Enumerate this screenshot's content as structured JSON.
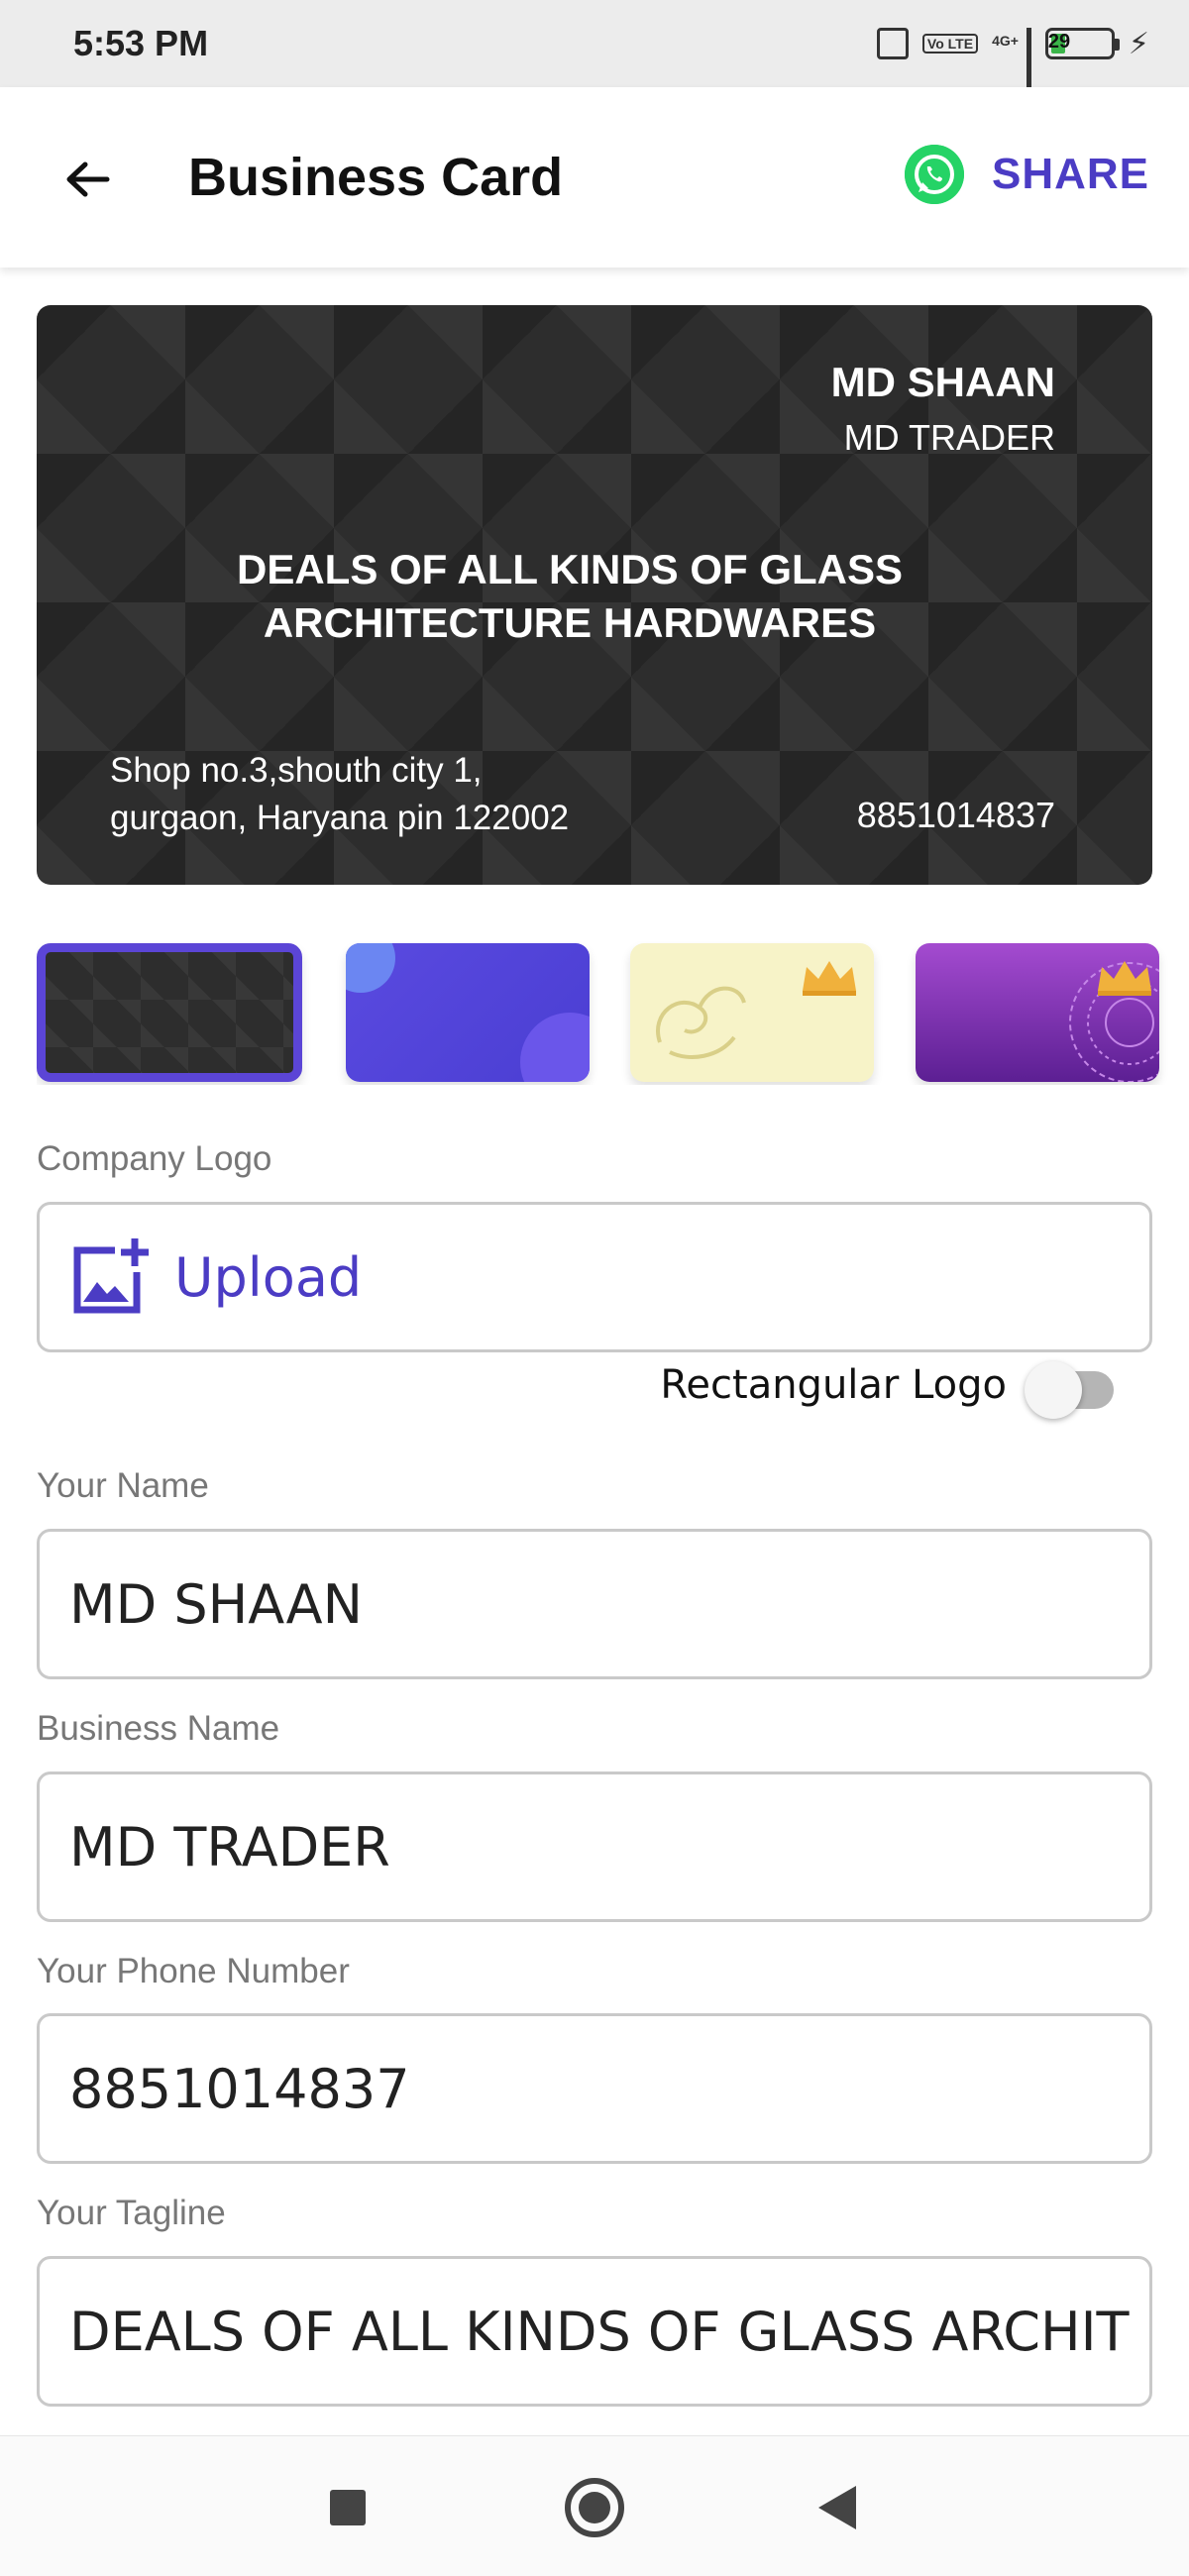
{
  "status_bar": {
    "time": "5:53 PM",
    "network": "4G+",
    "volte": "Vo LTE",
    "battery": "29"
  },
  "app_bar": {
    "title": "Business Card",
    "share_label": "SHARE"
  },
  "card": {
    "name": "MD SHAAN",
    "business": "MD TRADER",
    "tagline": "DEALS OF ALL KINDS OF GLASS ARCHITECTURE HARDWARES",
    "address_line1": "Shop no.3,shouth city 1,",
    "address_line2": "gurgaon, Haryana pin 122002",
    "phone": "8851014837"
  },
  "themes": {
    "items": [
      {
        "name": "dark-pattern",
        "selected": true,
        "premium": false
      },
      {
        "name": "blue-gradient",
        "selected": false,
        "premium": false
      },
      {
        "name": "cream-ornament",
        "selected": false,
        "premium": true
      },
      {
        "name": "purple-mandala",
        "selected": false,
        "premium": true
      }
    ],
    "accent": "#5b45d6"
  },
  "form": {
    "logo_label": "Company Logo",
    "upload_label": "Upload",
    "rect_logo_label": "Rectangular Logo",
    "rect_logo_on": false,
    "name_label": "Your Name",
    "name_value": "MD SHAAN",
    "business_label": "Business Name",
    "business_value": "MD TRADER",
    "phone_label": "Your Phone Number",
    "phone_value": "8851014837",
    "tagline_label": "Your Tagline",
    "tagline_value": "DEALS OF ALL KINDS OF GLASS ARCHIT"
  },
  "colors": {
    "brand": "#4b3cc4",
    "whatsapp": "#25d366",
    "premium_crown": "#f0b13c"
  }
}
